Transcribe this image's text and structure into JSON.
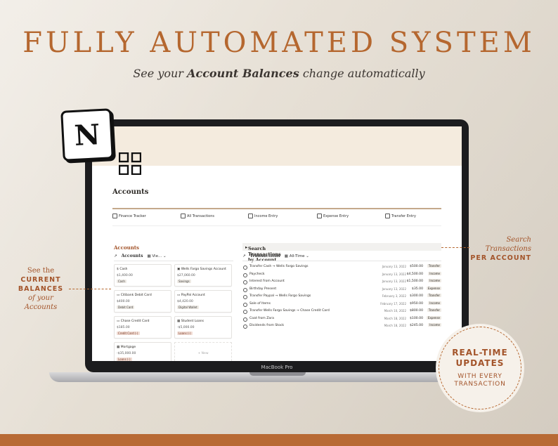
{
  "headline": "FULLY AUTOMATED SYSTEM",
  "subline": {
    "pre": "See your ",
    "bold": "Account Balances",
    "post": " change automatically"
  },
  "notion_logo_letter": "N",
  "device_label": "MacBook Pro",
  "page": {
    "title": "Accounts",
    "nav": [
      "Finance Tracker",
      "All Transactions",
      "Income Entry",
      "Expense Entry",
      "Transfer Entry"
    ]
  },
  "accounts": {
    "section_title": "Accounts",
    "view_label": "Accounts",
    "view_switch": "Vie...",
    "new_label": "+ New",
    "cards": [
      {
        "icon": "$",
        "name": "Cash",
        "balance": "$1,400.00",
        "tag": "Cash"
      },
      {
        "icon": "▣",
        "name": "Wells Fargo Savings Account",
        "balance": "$27,060.00",
        "tag": "Savings"
      },
      {
        "icon": "▭",
        "name": "Citibank Debit Card",
        "balance": "$400.00",
        "tag": "Debit Card"
      },
      {
        "icon": "▭",
        "name": "PayPal Account",
        "balance": "$4,420.00",
        "tag": "Digital Wallet"
      },
      {
        "icon": "▭",
        "name": "Chase Credit Card",
        "balance": "$185.00",
        "tag": "Credit Card (-)"
      },
      {
        "icon": "▦",
        "name": "Student Loans",
        "balance": "-$5,000.00",
        "tag": "Loans (-)"
      },
      {
        "icon": "▦",
        "name": "Mortgage",
        "balance": "-$35,000.00",
        "tag": "Loans (-)"
      }
    ]
  },
  "transactions": {
    "search_title": "Search Transactions by Account",
    "view_label": "Transactions",
    "filter": "All-Time",
    "rows": [
      {
        "name": "Transfer Cash → Wells Fargo Savings",
        "date": "January 13, 2022",
        "amount": "$500.00",
        "type": "Transfer"
      },
      {
        "name": "Paycheck",
        "date": "January 13, 2022",
        "amount": "$4,500.00",
        "type": "Income"
      },
      {
        "name": "Interest from Account",
        "date": "January 13, 2022",
        "amount": "$1,500.00",
        "type": "Income"
      },
      {
        "name": "Birthday Present",
        "date": "January 13, 2022",
        "amount": "$35.00",
        "type": "Expense"
      },
      {
        "name": "Transfer Paypal → Wells Fargo Savings",
        "date": "February 3, 2022",
        "amount": "$300.00",
        "type": "Transfer"
      },
      {
        "name": "Sale of Items",
        "date": "February 17, 2022",
        "amount": "$950.00",
        "type": "Income"
      },
      {
        "name": "Transfer Wells Fargo Savings → Chase Credit Card",
        "date": "March 10, 2022",
        "amount": "$800.00",
        "type": "Transfer"
      },
      {
        "name": "Coat from Zara",
        "date": "March 18, 2022",
        "amount": "$100.00",
        "type": "Expense"
      },
      {
        "name": "Dividends from Stock",
        "date": "March 18, 2022",
        "amount": "$245.00",
        "type": "Income"
      }
    ]
  },
  "left_note": {
    "l1": "See the",
    "l2": "CURRENT",
    "l3": "BALANCES",
    "l4": "of your",
    "l5": "Accounts"
  },
  "right_note": {
    "l1": "Search",
    "l2": "Transactions",
    "l3": "PER ACCOUNT"
  },
  "badge": {
    "t1": "REAL-TIME",
    "t2": "UPDATES",
    "t3": "WITH EVERY",
    "t4": "TRANSACTION"
  },
  "colors": {
    "accent": "#b5672f",
    "cover": "#f4ebde",
    "bottom_bar": "#b86a35"
  }
}
